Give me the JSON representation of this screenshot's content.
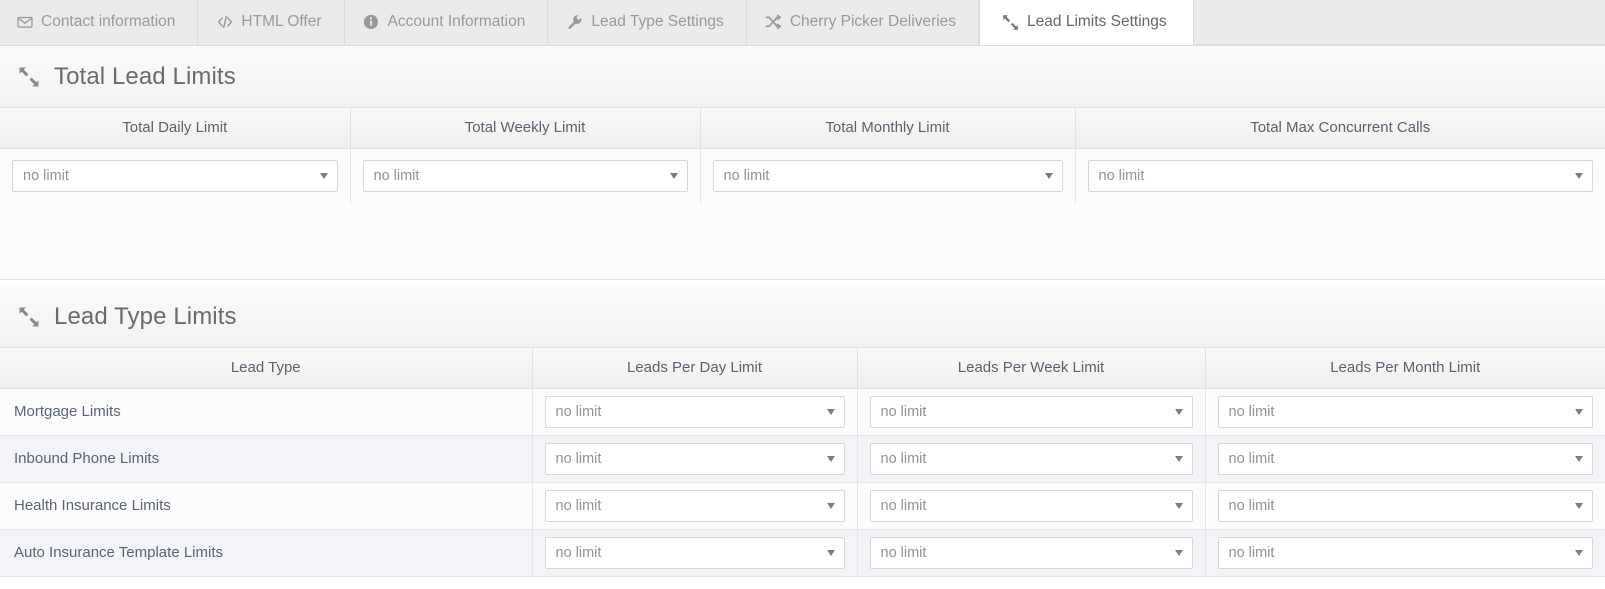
{
  "tabs": [
    {
      "label": "Contact information",
      "icon": "envelope-icon",
      "active": false
    },
    {
      "label": "HTML Offer",
      "icon": "code-icon",
      "active": false
    },
    {
      "label": "Account Information",
      "icon": "info-circle-icon",
      "active": false
    },
    {
      "label": "Lead Type Settings",
      "icon": "wrench-icon",
      "active": false
    },
    {
      "label": "Cherry Picker Deliveries",
      "icon": "shuffle-icon",
      "active": false
    },
    {
      "label": "Lead Limits Settings",
      "icon": "compress-arrows-icon",
      "active": true
    }
  ],
  "total_lead_limits": {
    "section_title": "Total Lead Limits",
    "section_icon": "compress-arrows-icon",
    "columns": [
      "Total Daily Limit",
      "Total Weekly Limit",
      "Total Monthly Limit",
      "Total Max Concurrent Calls"
    ],
    "values": [
      "no limit",
      "no limit",
      "no limit",
      "no limit"
    ],
    "options": [
      "no limit"
    ]
  },
  "lead_type_limits": {
    "section_title": "Lead Type Limits",
    "section_icon": "compress-arrows-icon",
    "columns": [
      "Lead Type",
      "Leads Per Day Limit",
      "Leads Per Week Limit",
      "Leads Per Month Limit"
    ],
    "rows": [
      {
        "lead_type": "Mortgage Limits",
        "per_day": "no limit",
        "per_week": "no limit",
        "per_month": "no limit"
      },
      {
        "lead_type": "Inbound Phone Limits",
        "per_day": "no limit",
        "per_week": "no limit",
        "per_month": "no limit"
      },
      {
        "lead_type": "Health Insurance Limits",
        "per_day": "no limit",
        "per_week": "no limit",
        "per_month": "no limit"
      },
      {
        "lead_type": "Auto Insurance Template Limits",
        "per_day": "no limit",
        "per_week": "no limit",
        "per_month": "no limit"
      }
    ],
    "options": [
      "no limit"
    ]
  },
  "colors": {
    "tabbar_bg": "#ebebeb",
    "active_tab_bg": "#ffffff",
    "tab_text": "#9a9a9a",
    "active_tab_text": "#666666",
    "section_title_text": "#6b6b6b",
    "table_header_text": "#5b6270",
    "lead_name_text": "#5a6475",
    "select_text": "#8f939c",
    "row_alt_bg": "#f2f4f7"
  }
}
